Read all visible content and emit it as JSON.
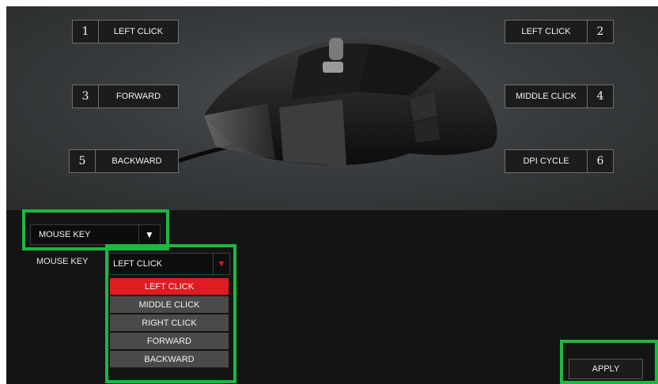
{
  "button_map": [
    {
      "num": "1",
      "label": "LEFT CLICK",
      "side": "left"
    },
    {
      "num": "2",
      "label": "LEFT CLICK",
      "side": "right"
    },
    {
      "num": "3",
      "label": "FORWARD",
      "side": "left"
    },
    {
      "num": "4",
      "label": "MIDDLE CLICK",
      "side": "right"
    },
    {
      "num": "5",
      "label": "BACKWARD",
      "side": "left"
    },
    {
      "num": "6",
      "label": "DPI CYCLE",
      "side": "right"
    }
  ],
  "config": {
    "category_value": "MOUSE KEY",
    "mouse_key_label": "MOUSE KEY",
    "mouse_key_value": "LEFT CLICK",
    "options": [
      "LEFT CLICK",
      "MIDDLE CLICK",
      "RIGHT CLICK",
      "FORWARD",
      "BACKWARD"
    ],
    "selected_option": "LEFT CLICK",
    "apply_label": "APPLY"
  },
  "icons": {
    "dropdown_arrow": "dropdown-arrow-icon",
    "mouse_image": "gaming-mouse-illustration"
  },
  "colors": {
    "accent_red": "#e11b22",
    "highlight_green": "#1db840",
    "background": "#151515"
  }
}
